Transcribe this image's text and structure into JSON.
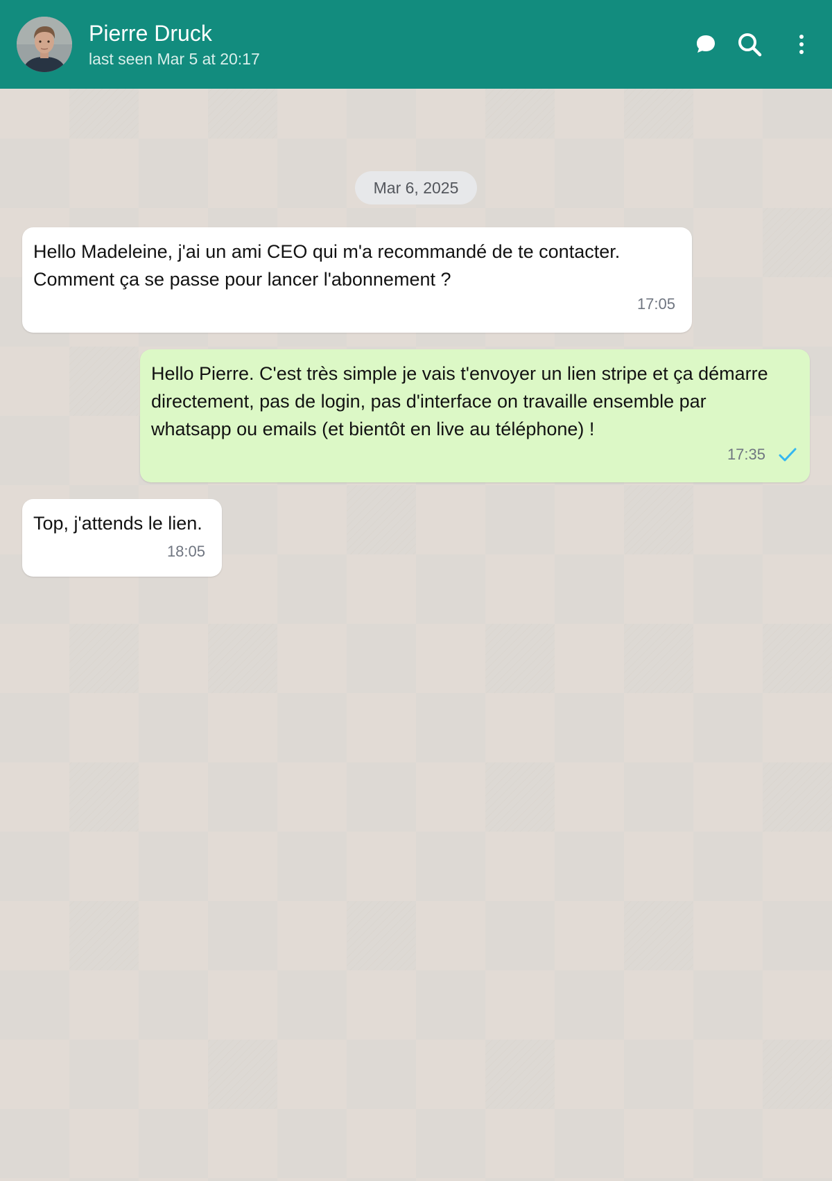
{
  "header": {
    "contact_name": "Pierre Druck",
    "status": "last seen Mar 5 at 20:17",
    "icons": [
      "chat-bubble-icon",
      "search-icon",
      "more-vertical-icon"
    ],
    "background_color": "#128c7e"
  },
  "chat": {
    "date_separator": "Mar 6, 2025",
    "messages": [
      {
        "direction": "incoming",
        "lines": [
          "Hello Madeleine, j'ai un ami CEO qui m'a recommandé de te contacter.",
          "Comment ça se passe pour lancer l'abonnement ?"
        ],
        "time": "17:05"
      },
      {
        "direction": "outgoing",
        "lines": [
          "Hello Pierre. C'est très simple je vais t'envoyer un lien stripe et ça démarre",
          "directement, pas de login, pas d'interface on travaille ensemble par",
          "whatsapp ou emails (et bientôt en live au téléphone) !"
        ],
        "time": "17:35",
        "status_icon": "single-check-icon"
      },
      {
        "direction": "incoming",
        "lines": [
          "Top, j'attends le lien."
        ],
        "time": "18:05"
      }
    ]
  },
  "colors": {
    "incoming_bubble": "#ffffff",
    "outgoing_bubble": "#dcf8c6",
    "check_mark": "#34b7f1"
  }
}
